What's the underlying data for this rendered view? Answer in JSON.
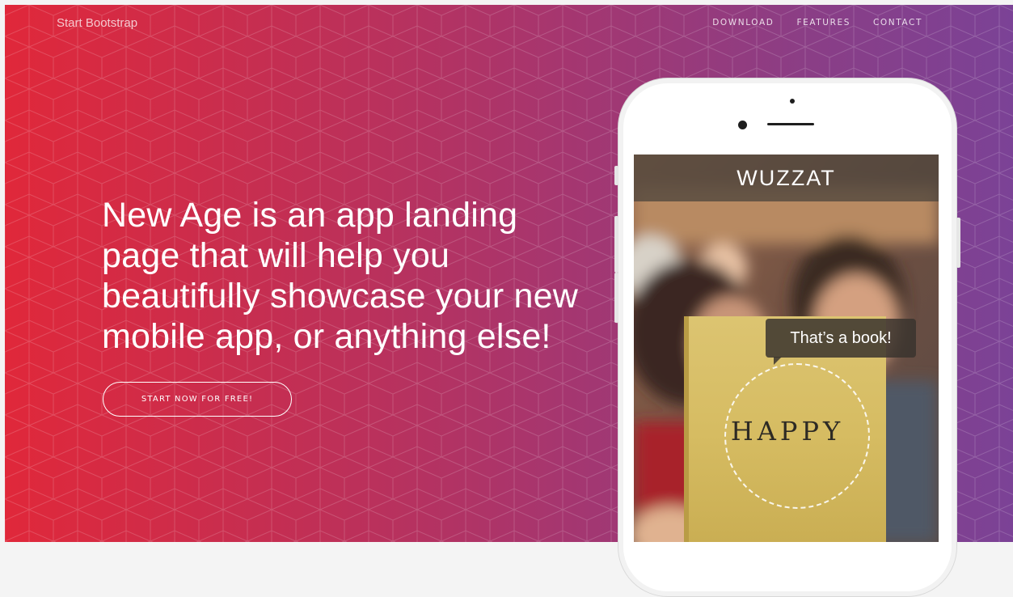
{
  "brand": "Start Bootstrap",
  "nav": {
    "items": [
      "DOWNLOAD",
      "FEATURES",
      "CONTACT"
    ]
  },
  "hero": {
    "headline": "New Age is an app landing page that will help you beautifully showcase your new mobile app, or anything else!",
    "cta_label": "START NOW FOR FREE!"
  },
  "device": {
    "app_title": "WUZZAT",
    "bubble_text": "That’s a book!",
    "book_text": "HAPPY"
  },
  "colors": {
    "gradient_start": "#e0283a",
    "gradient_end": "#7b4296",
    "text_primary": "#ffffff",
    "book_yellow": "#d6bc62"
  }
}
